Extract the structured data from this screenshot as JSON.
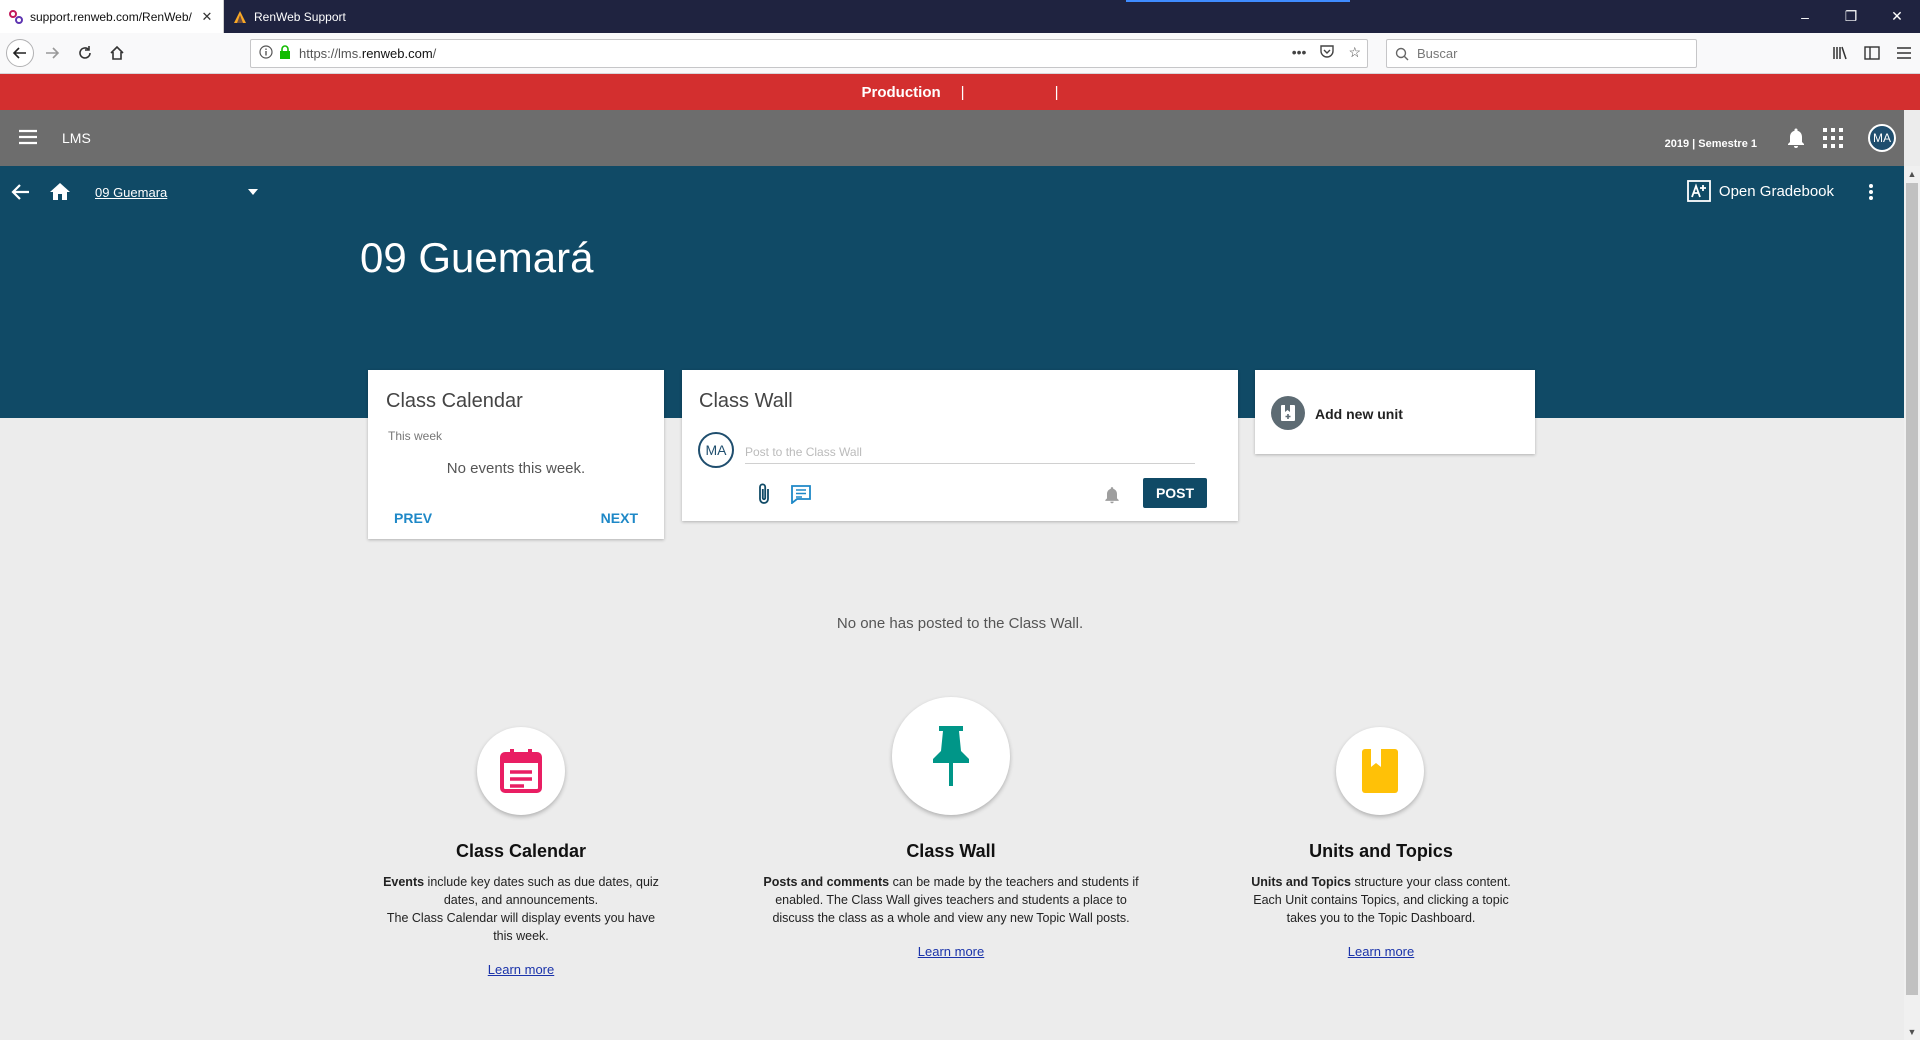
{
  "browser": {
    "tabs": [
      {
        "label": "support.renweb.com/RenWeb/",
        "active": true
      },
      {
        "label": "RenWeb Support",
        "active": false
      }
    ],
    "url_prefix": "https://lms.",
    "url_domain": "renweb.com",
    "url_suffix": "/",
    "search_placeholder": "Buscar",
    "window_controls": {
      "minimize": "–",
      "restore": "❐",
      "close": "✕"
    }
  },
  "banner_env": {
    "label": "Production",
    "separator": "|"
  },
  "app_header": {
    "app_name": "LMS",
    "term": "2019 | Semestre 1",
    "avatar_initials": "MA"
  },
  "class_banner": {
    "breadcrumb": "09 Guemara",
    "title": "09 Guemará",
    "gradebook_label": "Open Gradebook"
  },
  "calendar_card": {
    "title": "Class Calendar",
    "range": "This week",
    "empty": "No events this week.",
    "prev": "PREV",
    "next": "NEXT"
  },
  "wall_card": {
    "title": "Class Wall",
    "avatar_initials": "MA",
    "placeholder": "Post to the Class Wall",
    "post_button": "POST",
    "empty_message": "No one has posted to the Class Wall."
  },
  "unit_card": {
    "label": "Add new unit"
  },
  "features": [
    {
      "title": "Class Calendar",
      "bold": "Events",
      "desc": " include key dates such as due dates, quiz dates, and announcements.",
      "desc2": "The Class Calendar will display events you have this week.",
      "link": "Learn more"
    },
    {
      "title": "Class Wall",
      "bold": "Posts and comments",
      "desc": " can be made by the teachers and students if enabled. The Class Wall gives teachers and students a place to discuss the class as a whole and view any new Topic Wall posts.",
      "link": "Learn more"
    },
    {
      "title": "Units and Topics",
      "bold": "Units and Topics",
      "desc": " structure your class content. Each Unit contains Topics, and clicking a topic takes you to the Topic Dashboard.",
      "link": "Learn more"
    }
  ],
  "colors": {
    "tab_strip": "#1f2340",
    "production_red": "#d32f2f",
    "app_header_gray": "#6d6d6d",
    "banner_navy": "#104a66",
    "link_blue": "#1e88c7",
    "calendar_icon": "#e91e63",
    "pin_icon": "#009688",
    "book_icon": "#ffc107"
  },
  "icons": {
    "menu": "hamburger-icon",
    "bell": "bell-icon",
    "apps": "apps-grid-icon",
    "back": "arrow-back-icon",
    "home": "home-icon",
    "gradebook": "gradebook-icon",
    "kebab": "more-vert-icon",
    "attach": "paperclip-icon",
    "comment": "comment-icon",
    "add_unit": "add-unit-icon",
    "calendar": "calendar-icon",
    "pin": "pushpin-icon",
    "book": "book-icon"
  }
}
